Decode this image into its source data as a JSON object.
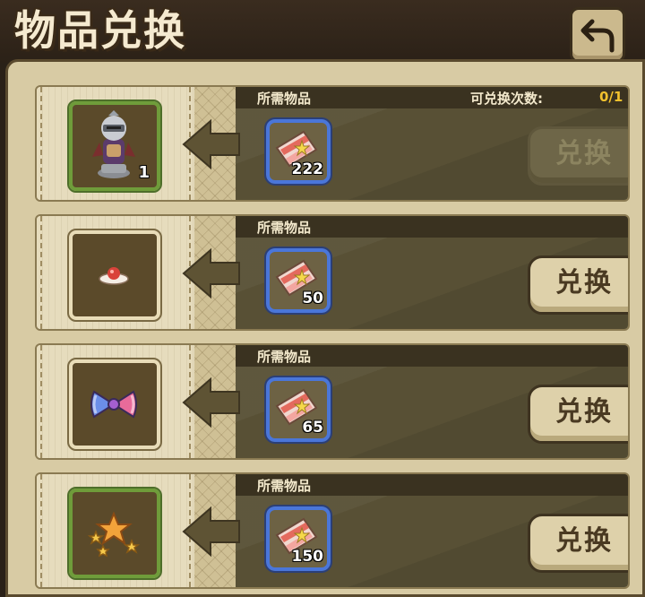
{
  "header": {
    "title": "物品兑换",
    "back_icon": "back-arrow-icon"
  },
  "rows": [
    {
      "reward_icon": "knight-figure-icon",
      "reward_count": "1",
      "slot_color": "#6f9c3a",
      "required_label": "所需物品",
      "limit_label": "可兑换次数:",
      "limit_value": "0/1",
      "cost_icon": "ticket-icon",
      "cost": "222",
      "button_label": "兑换",
      "button_state": "disabled"
    },
    {
      "reward_icon": "red-orb-plate-icon",
      "reward_count": "",
      "slot_color": "#e8dcb8",
      "required_label": "所需物品",
      "cost_icon": "ticket-icon",
      "cost": "50",
      "button_label": "兑换",
      "button_state": "enabled"
    },
    {
      "reward_icon": "bow-ribbon-icon",
      "reward_count": "",
      "slot_color": "#e8dcb8",
      "required_label": "所需物品",
      "cost_icon": "ticket-icon",
      "cost": "65",
      "button_label": "兑换",
      "button_state": "enabled"
    },
    {
      "reward_icon": "stars-icon",
      "reward_count": "",
      "slot_color": "#6f9c3a",
      "required_label": "所需物品",
      "cost_icon": "ticket-icon",
      "cost": "150",
      "button_label": "兑换",
      "button_state": "enabled"
    }
  ]
}
